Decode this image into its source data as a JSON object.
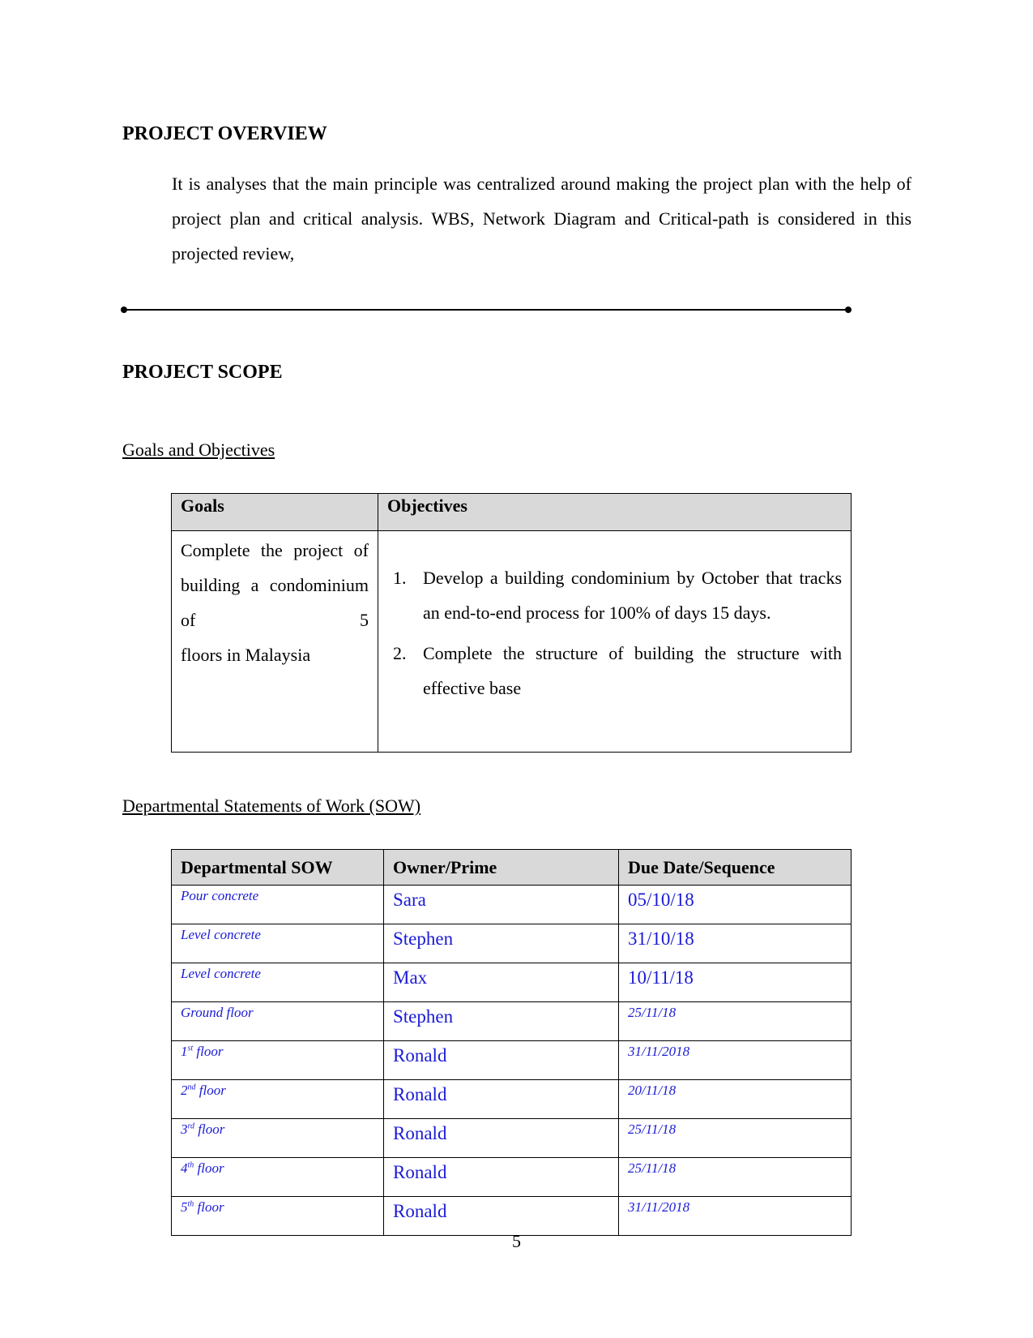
{
  "overview": {
    "heading": "PROJECT OVERVIEW",
    "paragraph": "It is analyses that the main principle was centralized around making the project plan with the help of project plan and critical analysis. WBS, Network Diagram and Critical-path is considered in this projected review,"
  },
  "scope": {
    "heading": "PROJECT SCOPE",
    "goals_subheading": "Goals and Objectives",
    "goals_table": {
      "headers": [
        "Goals",
        "Objectives"
      ],
      "goal_text": "Complete the project of building a condominium of 5",
      "goal_text_last": "floors in Malaysia",
      "objectives": [
        {
          "number": "1.",
          "text": "Develop a building condominium by October that tracks an end-to-end process for 100% of days 15 days."
        },
        {
          "number": "2.",
          "text": "Complete the structure of building the structure with effective base"
        }
      ]
    },
    "sow_subheading": "Departmental Statements of Work (SOW)",
    "sow_table": {
      "headers": [
        "Departmental SOW",
        "Owner/Prime",
        "Due Date/Sequence"
      ],
      "rows": [
        {
          "sow": "Pour concrete",
          "sow_sup": "",
          "sow_suffix": "",
          "owner": "Sara",
          "due": "05/10/18",
          "due_style": "big"
        },
        {
          "sow": "Level concrete",
          "sow_sup": "",
          "sow_suffix": "",
          "owner": "Stephen",
          "due": "31/10/18",
          "due_style": "big"
        },
        {
          "sow": "Level concrete",
          "sow_sup": "",
          "sow_suffix": "",
          "owner": "Max",
          "due": "10/11/18",
          "due_style": "big"
        },
        {
          "sow": "Ground floor",
          "sow_sup": "",
          "sow_suffix": "",
          "owner": "Stephen",
          "due": "25/11/18",
          "due_style": "small"
        },
        {
          "sow": "1",
          "sow_sup": "st",
          "sow_suffix": " floor",
          "owner": "Ronald",
          "due": "31/11/2018",
          "due_style": "small"
        },
        {
          "sow": "2",
          "sow_sup": "nd",
          "sow_suffix": " floor",
          "owner": "Ronald",
          "due": "20/11/18",
          "due_style": "small"
        },
        {
          "sow": "3",
          "sow_sup": "rd",
          "sow_suffix": " floor",
          "owner": "Ronald",
          "due": "25/11/18",
          "due_style": "small"
        },
        {
          "sow": "4",
          "sow_sup": "th",
          "sow_suffix": " floor",
          "owner": "Ronald",
          "due": "25/11/18",
          "due_style": "small"
        },
        {
          "sow": "5",
          "sow_sup": "th",
          "sow_suffix": " floor",
          "owner": "Ronald",
          "due": "31/11/2018",
          "due_style": "small"
        }
      ]
    }
  },
  "colors": {
    "table_text_blue": "#1a1ad6",
    "header_fill": "#d9d9d9"
  },
  "page_number": "5"
}
